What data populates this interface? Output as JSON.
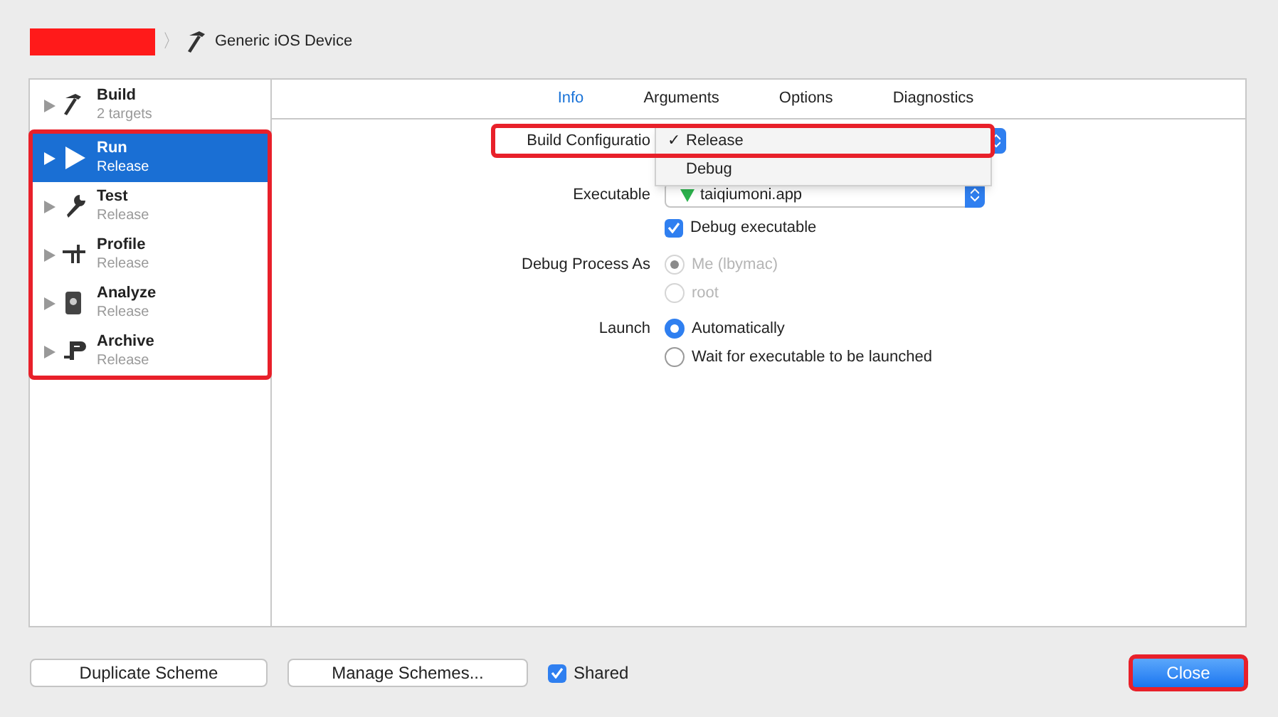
{
  "breadcrumb": {
    "scheme": {
      "redacted": true
    },
    "separator": "〉",
    "destination": "Generic iOS Device"
  },
  "sidebar": {
    "items": [
      {
        "kind": "build",
        "title": "Build",
        "subtitle": "2 targets",
        "selected": false,
        "highlighted": false
      },
      {
        "kind": "run",
        "title": "Run",
        "subtitle": "Release",
        "selected": true,
        "highlighted": true
      },
      {
        "kind": "test",
        "title": "Test",
        "subtitle": "Release",
        "selected": false,
        "highlighted": true
      },
      {
        "kind": "profile",
        "title": "Profile",
        "subtitle": "Release",
        "selected": false,
        "highlighted": true
      },
      {
        "kind": "analyze",
        "title": "Analyze",
        "subtitle": "Release",
        "selected": false,
        "highlighted": true
      },
      {
        "kind": "archive",
        "title": "Archive",
        "subtitle": "Release",
        "selected": false,
        "highlighted": true
      }
    ]
  },
  "tabs": [
    {
      "label": "Info",
      "selected": true
    },
    {
      "label": "Arguments",
      "selected": false
    },
    {
      "label": "Options",
      "selected": false
    },
    {
      "label": "Diagnostics",
      "selected": false
    }
  ],
  "form": [
    {
      "kind": "popup",
      "label": "Build Configuratio",
      "highlighted": true,
      "check_glyph": "✓",
      "menu": [
        {
          "label": "Release",
          "checked": true
        },
        {
          "label": "Debug",
          "checked": false
        }
      ]
    },
    {
      "kind": "popup",
      "label": "Executable",
      "value": "taiqiumoni.app",
      "app_icon": true
    },
    {
      "kind": "checkbox",
      "text": "Debug executable",
      "checked": true
    },
    {
      "kind": "radio",
      "label": "Debug Process As",
      "text": "Me (lbymac)",
      "selected": true,
      "disabled": true
    },
    {
      "kind": "radio",
      "text": "root",
      "selected": false,
      "disabled": true
    },
    {
      "kind": "radio",
      "label": "Launch",
      "text": "Automatically",
      "selected": true,
      "disabled": false
    },
    {
      "kind": "radio",
      "text": "Wait for executable to be launched",
      "selected": false,
      "disabled": false
    }
  ],
  "footer": {
    "buttons": [
      {
        "label": "Duplicate Scheme"
      },
      {
        "label": "Manage Schemes..."
      }
    ],
    "shared": {
      "text": "Shared",
      "checked": true
    },
    "close": {
      "label": "Close",
      "highlighted": true
    }
  }
}
